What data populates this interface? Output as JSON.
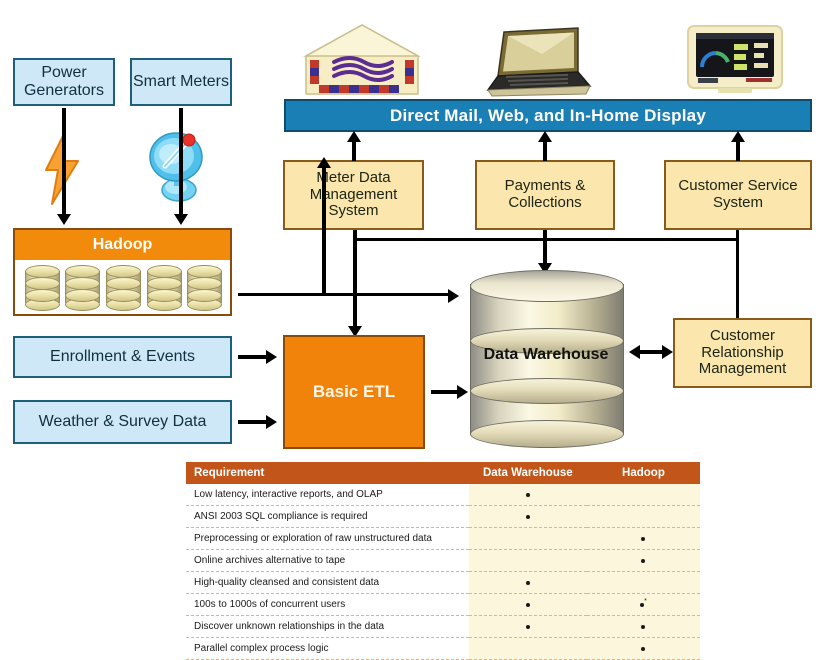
{
  "diagram": {
    "sources": [
      {
        "id": "power-generators",
        "label": "Power Generators"
      },
      {
        "id": "smart-meters",
        "label": "Smart Meters"
      }
    ],
    "hadoop": {
      "title": "Hadoop",
      "node_count": 5
    },
    "feeds": [
      {
        "id": "enrollment-events",
        "label": "Enrollment & Events"
      },
      {
        "id": "weather-survey",
        "label": "Weather & Survey Data"
      }
    ],
    "etl": {
      "label": "Basic ETL"
    },
    "banner": {
      "label": "Direct Mail, Web, and In-Home Display"
    },
    "systems": [
      {
        "id": "meter-data-management-system",
        "label": "Meter Data Management System"
      },
      {
        "id": "payments-collections",
        "label": "Payments & Collections"
      },
      {
        "id": "customer-service-system",
        "label": "Customer Service System"
      }
    ],
    "warehouse": {
      "label": "Data Warehouse"
    },
    "crm": {
      "label": "Customer Relationship Management"
    },
    "icons": [
      {
        "id": "airmail-envelope-icon",
        "title": "Direct Mail"
      },
      {
        "id": "laptop-icon",
        "title": "Web"
      },
      {
        "id": "in-home-display-icon",
        "title": "In-Home Display"
      },
      {
        "id": "lightning-bolt-icon",
        "title": "Power"
      },
      {
        "id": "satellite-dish-icon",
        "title": "Smart Meter Telemetry"
      }
    ],
    "colors": {
      "hadoop_orange": "#f28a0c",
      "etl_orange": "#f1830b",
      "banner_blue": "#1a7fb5",
      "source_blue": "#cfe8f7",
      "system_cream": "#fbe6ad",
      "table_header": "#c2561a",
      "table_highlight": "#fbf6dc"
    }
  },
  "comparison_table": {
    "columns": [
      "Requirement",
      "Data Warehouse",
      "Hadoop"
    ],
    "rows": [
      {
        "requirement": "Low latency, interactive reports,  and OLAP",
        "data_warehouse": true,
        "hadoop": false
      },
      {
        "requirement": "ANSI 2003 SQL compliance is required",
        "data_warehouse": true,
        "hadoop": false
      },
      {
        "requirement": "Preprocessing or exploration of raw unstructured data",
        "data_warehouse": false,
        "hadoop": true
      },
      {
        "requirement": "Online archives alternative to tape",
        "data_warehouse": false,
        "hadoop": true
      },
      {
        "requirement": "High-quality cleansed and consistent data",
        "data_warehouse": true,
        "hadoop": false
      },
      {
        "requirement": "100s to 1000s of concurrent users",
        "data_warehouse": true,
        "hadoop": true,
        "hadoop_footnote": "*"
      },
      {
        "requirement": "Discover unknown relationships in the data",
        "data_warehouse": true,
        "hadoop": true
      },
      {
        "requirement": "Parallel complex process logic",
        "data_warehouse": false,
        "hadoop": true
      }
    ]
  }
}
